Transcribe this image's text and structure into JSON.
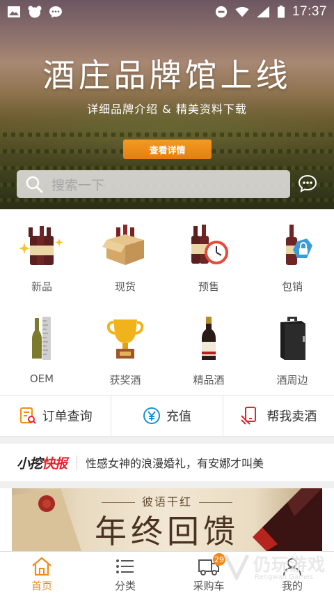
{
  "status_bar": {
    "time": "17:37"
  },
  "banner": {
    "title": "酒庄品牌馆上线",
    "subtitle": "详细品牌介绍 & 精美资料下载",
    "button": "查看详情",
    "search_placeholder": "搜索一下"
  },
  "categories": [
    {
      "label": "新品",
      "icon": "wine-bottles-sparkle-icon"
    },
    {
      "label": "现货",
      "icon": "wine-box-icon"
    },
    {
      "label": "预售",
      "icon": "wine-clock-icon"
    },
    {
      "label": "包销",
      "icon": "wine-lock-icon"
    },
    {
      "label": "OEM",
      "icon": "bottle-ruler-icon"
    },
    {
      "label": "获奖酒",
      "icon": "trophy-icon"
    },
    {
      "label": "精品酒",
      "icon": "premium-bottle-icon"
    },
    {
      "label": "酒周边",
      "icon": "wine-case-icon"
    }
  ],
  "quick_actions": [
    {
      "label": "订单查询",
      "icon": "order-search-icon"
    },
    {
      "label": "充值",
      "icon": "yen-circle-icon"
    },
    {
      "label": "帮我卖酒",
      "icon": "phone-hand-icon"
    }
  ],
  "news": {
    "logo_part1": "小挖",
    "logo_part2": "快报",
    "headline": "性感女神的浪漫婚礼，有安娜才叫美"
  },
  "promo": {
    "subtitle": "彼语干红",
    "title": "年终回馈"
  },
  "tabs": [
    {
      "label": "首页",
      "icon": "home-icon",
      "active": true
    },
    {
      "label": "分类",
      "icon": "list-icon",
      "active": false
    },
    {
      "label": "采购车",
      "icon": "truck-icon",
      "active": false,
      "badge": "29"
    },
    {
      "label": "我的",
      "icon": "user-icon",
      "active": false
    }
  ],
  "watermark": {
    "text": "仍玩游戏",
    "sub": "Rengwan Games"
  },
  "colors": {
    "accent": "#f08a19",
    "news_red": "#e5232a"
  }
}
